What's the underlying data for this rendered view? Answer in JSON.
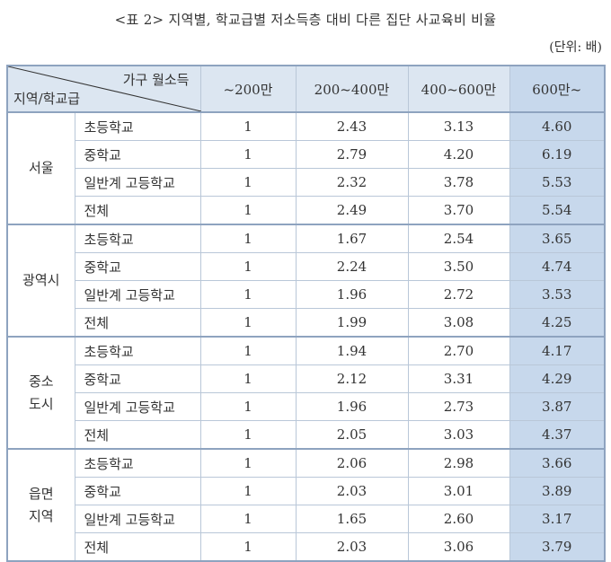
{
  "caption": "<표 2> 지역별, 학교급별 저소득층 대비 다른 집단 사교육비 비율",
  "unit": "(단위: 배)",
  "header": {
    "diag_top": "가구 월소득",
    "diag_bottom": "지역/학교급",
    "cols": [
      "~200만",
      "200~400만",
      "400~600만",
      "600만~"
    ]
  },
  "regions": [
    {
      "name_lines": [
        "서울"
      ],
      "rows": [
        {
          "level": "초등학교",
          "values": [
            "1",
            "2.43",
            "3.13",
            "4.60"
          ]
        },
        {
          "level": "중학교",
          "values": [
            "1",
            "2.79",
            "4.20",
            "6.19"
          ]
        },
        {
          "level": "일반계 고등학교",
          "values": [
            "1",
            "2.32",
            "3.78",
            "5.53"
          ]
        },
        {
          "level": "전체",
          "values": [
            "1",
            "2.49",
            "3.70",
            "5.54"
          ]
        }
      ]
    },
    {
      "name_lines": [
        "광역시"
      ],
      "rows": [
        {
          "level": "초등학교",
          "values": [
            "1",
            "1.67",
            "2.54",
            "3.65"
          ]
        },
        {
          "level": "중학교",
          "values": [
            "1",
            "2.24",
            "3.50",
            "4.74"
          ]
        },
        {
          "level": "일반계 고등학교",
          "values": [
            "1",
            "1.96",
            "2.72",
            "3.53"
          ]
        },
        {
          "level": "전체",
          "values": [
            "1",
            "1.99",
            "3.08",
            "4.25"
          ]
        }
      ]
    },
    {
      "name_lines": [
        "중소",
        "도시"
      ],
      "rows": [
        {
          "level": "초등학교",
          "values": [
            "1",
            "1.94",
            "2.70",
            "4.17"
          ]
        },
        {
          "level": "중학교",
          "values": [
            "1",
            "2.12",
            "3.31",
            "4.29"
          ]
        },
        {
          "level": "일반계 고등학교",
          "values": [
            "1",
            "1.96",
            "2.73",
            "3.87"
          ]
        },
        {
          "level": "전체",
          "values": [
            "1",
            "2.05",
            "3.03",
            "4.37"
          ]
        }
      ]
    },
    {
      "name_lines": [
        "읍면",
        "지역"
      ],
      "rows": [
        {
          "level": "초등학교",
          "values": [
            "1",
            "2.06",
            "2.98",
            "3.66"
          ]
        },
        {
          "level": "중학교",
          "values": [
            "1",
            "2.03",
            "3.01",
            "3.89"
          ]
        },
        {
          "level": "일반계 고등학교",
          "values": [
            "1",
            "1.65",
            "2.60",
            "3.17"
          ]
        },
        {
          "level": "전체",
          "values": [
            "1",
            "2.03",
            "3.06",
            "3.79"
          ]
        }
      ]
    }
  ]
}
